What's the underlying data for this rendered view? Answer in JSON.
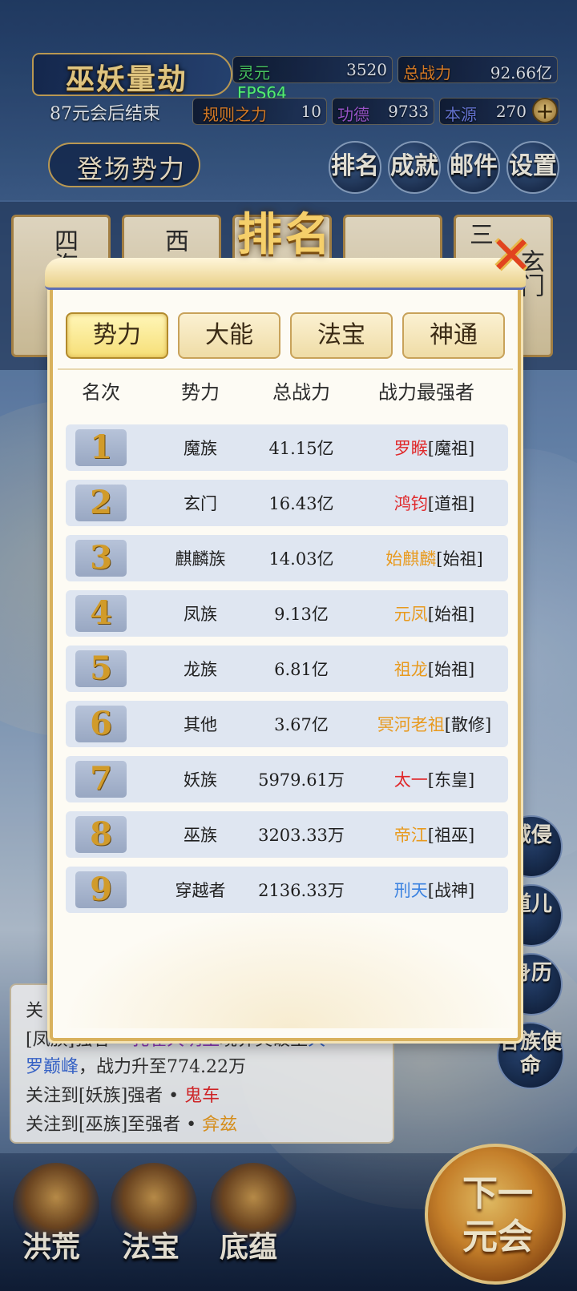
{
  "hud": {
    "game_title": "巫妖量劫",
    "countdown": "87元会后结束",
    "fps": "FPS64",
    "stats": [
      {
        "label": "灵元",
        "value": "3520",
        "color": "#4fd66a"
      },
      {
        "label": "总战力",
        "value": "92.66亿",
        "color": "#e5842a"
      },
      {
        "label": "规则之力",
        "value": "10",
        "color": "#e5842a"
      },
      {
        "label": "功德",
        "value": "9733",
        "color": "#a25bd6"
      },
      {
        "label": "本源",
        "value": "270",
        "color": "#6b7ce0"
      }
    ],
    "plus": "+",
    "deploy_label": "登场势力",
    "menu": [
      "排名",
      "成就",
      "邮件",
      "设置"
    ]
  },
  "faction_cards": [
    "四海汪洋",
    "西",
    "三",
    "玄门"
  ],
  "modal": {
    "title": "排名",
    "close": "✕",
    "tabs": [
      "势力",
      "大能",
      "法宝",
      "神通"
    ],
    "active_tab": 0,
    "headers": [
      "名次",
      "势力",
      "总战力",
      "战力最强者"
    ],
    "rows": [
      {
        "rank": "1",
        "faction": "魔族",
        "power": "41.15亿",
        "name": "罗睺",
        "title": "[魔祖]",
        "name_color": "#e0282a"
      },
      {
        "rank": "2",
        "faction": "玄门",
        "power": "16.43亿",
        "name": "鸿钧",
        "title": "[道祖]",
        "name_color": "#e0282a"
      },
      {
        "rank": "3",
        "faction": "麒麟族",
        "power": "14.03亿",
        "name": "始麒麟",
        "title": "[始祖]",
        "name_color": "#e89a1e"
      },
      {
        "rank": "4",
        "faction": "凤族",
        "power": "9.13亿",
        "name": "元凤",
        "title": "[始祖]",
        "name_color": "#e89a1e"
      },
      {
        "rank": "5",
        "faction": "龙族",
        "power": "6.81亿",
        "name": "祖龙",
        "title": "[始祖]",
        "name_color": "#e89a1e"
      },
      {
        "rank": "6",
        "faction": "其他",
        "power": "3.67亿",
        "name": "冥河老祖",
        "title": "[散修]",
        "name_color": "#e89a1e"
      },
      {
        "rank": "7",
        "faction": "妖族",
        "power": "5979.61万",
        "name": "太一",
        "title": "[东皇]",
        "name_color": "#e0282a"
      },
      {
        "rank": "8",
        "faction": "巫族",
        "power": "3203.33万",
        "name": "帝江",
        "title": "[祖巫]",
        "name_color": "#e89a1e"
      },
      {
        "rank": "9",
        "faction": "穿越者",
        "power": "2136.33万",
        "name": "刑天",
        "title": "[战神]",
        "name_color": "#3b82e0"
      }
    ]
  },
  "messages": {
    "line0": "关",
    "line1a": "[凤族]强者 • ",
    "line1b": "孔雀大明王",
    "line1c": "境界突破至",
    "line1d": "大",
    "line2a": "罗巅峰",
    "line2b": "，战力升至774.22万",
    "line3a": "关注到[妖族]强者 • ",
    "line3b": "鬼车",
    "line4a": "关注到[巫族]至强者 • ",
    "line4b": "弇兹"
  },
  "side_buttons": [
    "域侵",
    "道儿",
    "身历",
    "各族使命"
  ],
  "bottom_nav": [
    "洪荒",
    "法宝",
    "底蕴"
  ],
  "next_button": "下一元会"
}
